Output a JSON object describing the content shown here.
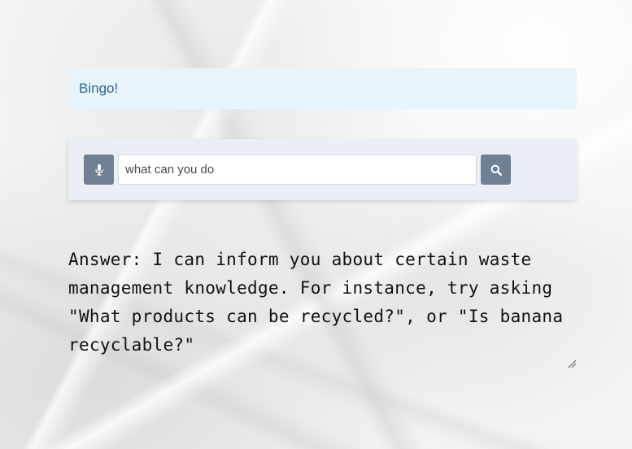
{
  "status": {
    "message": "Bingo!"
  },
  "search": {
    "query": "what can you do",
    "mic_icon": "microphone-icon",
    "search_icon": "magnifier-icon"
  },
  "answer": {
    "text": "Answer: I can inform you about certain waste management knowledge. For instance, try asking \"What products can be recycled?\", or \"Is banana recyclable?\""
  },
  "colors": {
    "alert_background": "#e8f4fc",
    "alert_text": "#31658e",
    "button_background": "#6f7f94",
    "panel_background": "#e9eff5"
  }
}
